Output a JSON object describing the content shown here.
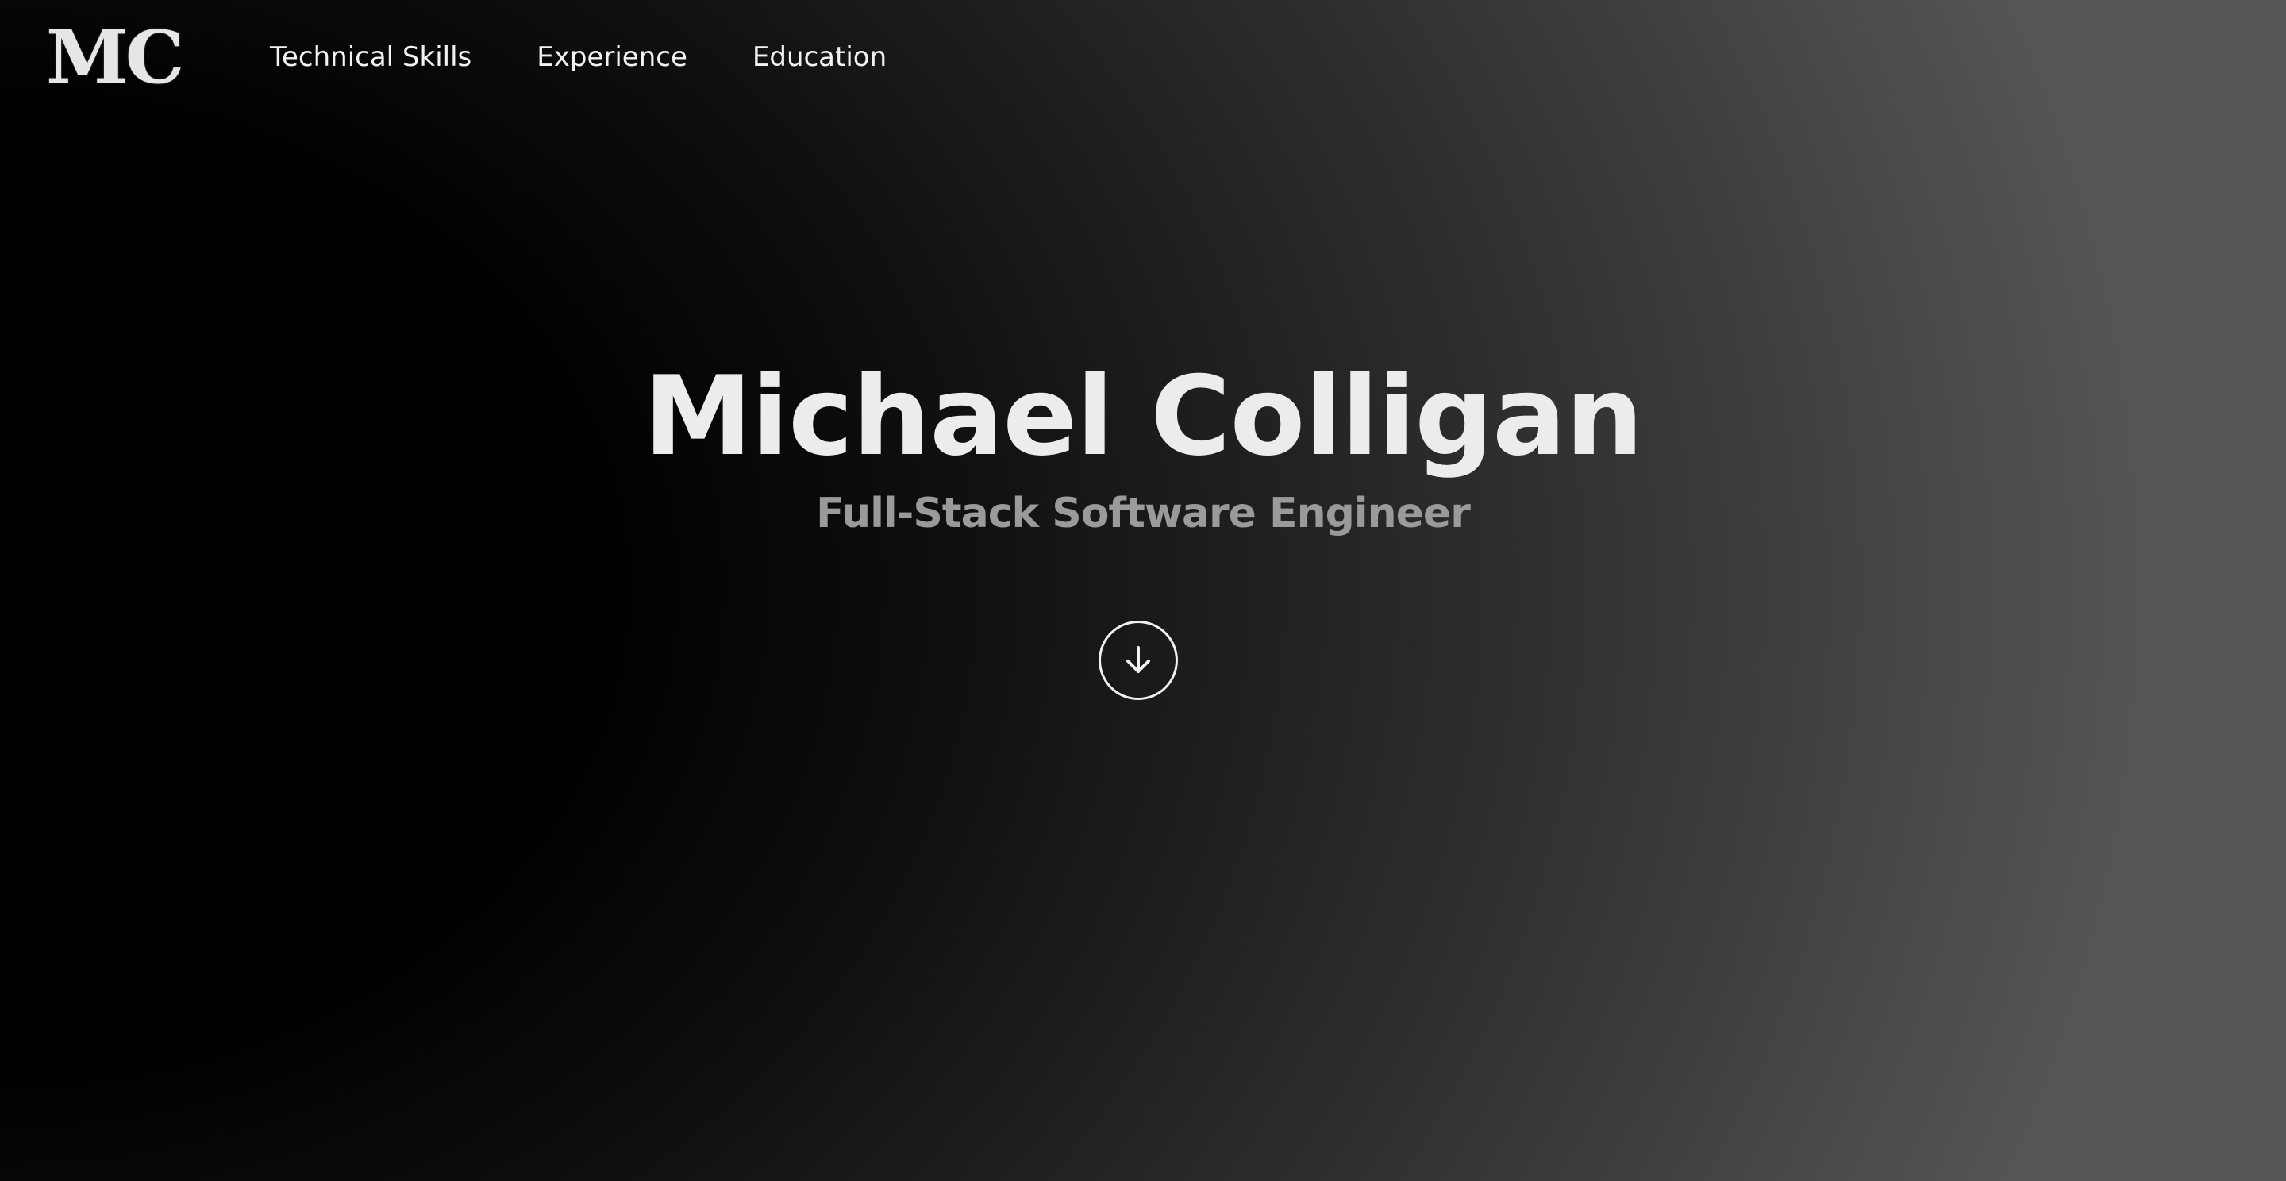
{
  "header": {
    "logo_text": "MC",
    "nav": [
      {
        "label": "Technical Skills"
      },
      {
        "label": "Experience"
      },
      {
        "label": "Education"
      }
    ]
  },
  "hero": {
    "title": "Michael Colligan",
    "subtitle": "Full-Stack Software Engineer",
    "scroll_icon": "arrow-down-circle-icon"
  },
  "colors": {
    "text_primary": "#ececec",
    "text_secondary": "#9a9a9a",
    "background_dark": "#000000",
    "background_light": "#555555"
  }
}
